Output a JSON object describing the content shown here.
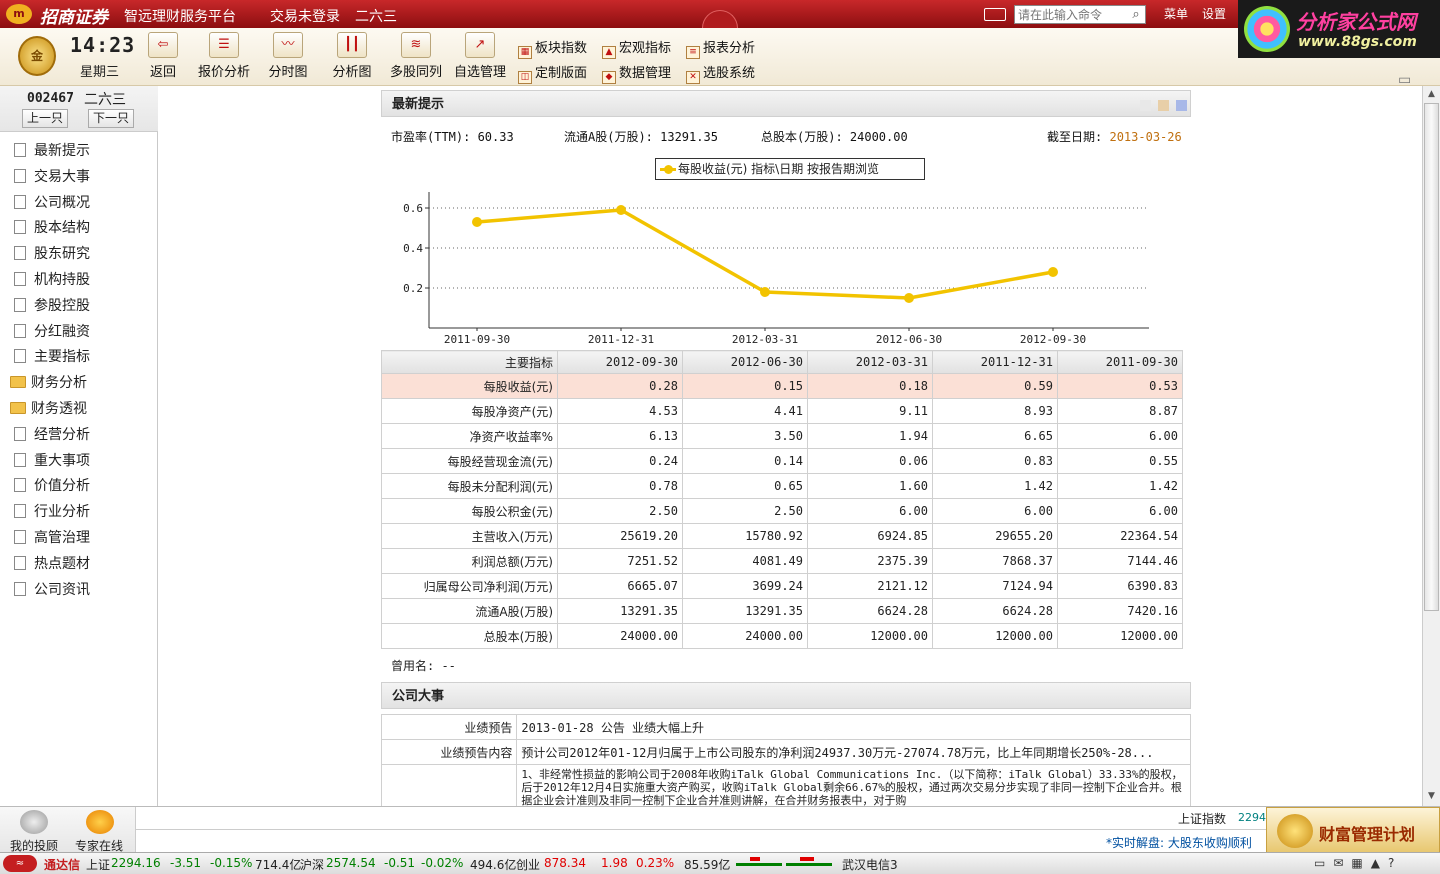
{
  "titlebar": {
    "logo_badge": "m",
    "brand": "招商证券",
    "platform": "智远理财服务平台",
    "login_status": "交易未登录",
    "stock_name": "二六三",
    "command_placeholder": "请在此输入命令",
    "menu_label": "菜单",
    "settings_label": "设置"
  },
  "toolbar": {
    "gold_badge": "金",
    "clock": "14:23",
    "weekday": "星期三",
    "buttons": [
      {
        "label": "返回",
        "icon": "back-arrow-icon"
      },
      {
        "label": "报价分析",
        "icon": "quote-analysis-icon"
      },
      {
        "label": "分时图",
        "icon": "intraday-chart-icon"
      },
      {
        "label": "分析图",
        "icon": "candlestick-chart-icon"
      },
      {
        "label": "多股同列",
        "icon": "multi-stock-icon"
      },
      {
        "label": "自选管理",
        "icon": "watchlist-icon"
      }
    ],
    "small_buttons": [
      {
        "label": "板块指数"
      },
      {
        "label": "宏观指标"
      },
      {
        "label": "报表分析"
      },
      {
        "label": "定制版面"
      },
      {
        "label": "数据管理"
      },
      {
        "label": "选股系统"
      }
    ]
  },
  "ad": {
    "title": "分析家公式网",
    "url": "www.88gs.com"
  },
  "sidebar": {
    "stock_code": "002467",
    "stock_name": "二六三",
    "prev_label": "上一只",
    "next_label": "下一只",
    "items": [
      {
        "label": "最新提示",
        "type": "doc"
      },
      {
        "label": "交易大事",
        "type": "doc"
      },
      {
        "label": "公司概况",
        "type": "doc"
      },
      {
        "label": "股本结构",
        "type": "doc"
      },
      {
        "label": "股东研究",
        "type": "doc"
      },
      {
        "label": "机构持股",
        "type": "doc"
      },
      {
        "label": "参股控股",
        "type": "doc"
      },
      {
        "label": "分红融资",
        "type": "doc"
      },
      {
        "label": "主要指标",
        "type": "doc"
      },
      {
        "label": "财务分析",
        "type": "folder"
      },
      {
        "label": "财务透视",
        "type": "folder"
      },
      {
        "label": "经营分析",
        "type": "doc"
      },
      {
        "label": "重大事项",
        "type": "doc"
      },
      {
        "label": "价值分析",
        "type": "doc"
      },
      {
        "label": "行业分析",
        "type": "doc"
      },
      {
        "label": "高管治理",
        "type": "doc"
      },
      {
        "label": "热点题材",
        "type": "doc"
      },
      {
        "label": "公司资讯",
        "type": "doc"
      }
    ]
  },
  "latest": {
    "title": "最新提示",
    "pe_label": "市盈率(TTM): 60.33",
    "float_label": "流通A股(万股): 13291.35",
    "total_label": "总股本(万股): 24000.00",
    "as_of_label": "截至日期:",
    "as_of_value": "2013-03-26",
    "used_name": "曾用名: --"
  },
  "chart_data": {
    "type": "line",
    "legend": "每股收益(元)   指标\\日期   按报告期浏览",
    "x": [
      "2011-09-30",
      "2011-12-31",
      "2012-03-31",
      "2012-06-30",
      "2012-09-30"
    ],
    "series": [
      {
        "name": "每股收益(元)",
        "values": [
          0.53,
          0.59,
          0.18,
          0.15,
          0.28
        ]
      }
    ],
    "yticks": [
      "0.2",
      "0.4",
      "0.6"
    ],
    "ylim": [
      0,
      0.68
    ],
    "grid": true,
    "color": "#f2c300"
  },
  "metrics": {
    "header": [
      "主要指标",
      "2012-09-30",
      "2012-06-30",
      "2012-03-31",
      "2011-12-31",
      "2011-09-30"
    ],
    "rows": [
      [
        "每股收益(元)",
        "0.28",
        "0.15",
        "0.18",
        "0.59",
        "0.53"
      ],
      [
        "每股净资产(元)",
        "4.53",
        "4.41",
        "9.11",
        "8.93",
        "8.87"
      ],
      [
        "净资产收益率%",
        "6.13",
        "3.50",
        "1.94",
        "6.65",
        "6.00"
      ],
      [
        "每股经营现金流(元)",
        "0.24",
        "0.14",
        "0.06",
        "0.83",
        "0.55"
      ],
      [
        "每股未分配利润(元)",
        "0.78",
        "0.65",
        "1.60",
        "1.42",
        "1.42"
      ],
      [
        "每股公积金(元)",
        "2.50",
        "2.50",
        "6.00",
        "6.00",
        "6.00"
      ],
      [
        "主营收入(万元)",
        "25619.20",
        "15780.92",
        "6924.85",
        "29655.20",
        "22364.54"
      ],
      [
        "利润总额(万元)",
        "7251.52",
        "4081.49",
        "2375.39",
        "7868.37",
        "7144.46"
      ],
      [
        "归属母公司净利润(万元)",
        "6665.07",
        "3699.24",
        "2121.12",
        "7124.94",
        "6390.83"
      ],
      [
        "流通A股(万股)",
        "13291.35",
        "13291.35",
        "6624.28",
        "6624.28",
        "7420.16"
      ],
      [
        "总股本(万股)",
        "24000.00",
        "24000.00",
        "12000.00",
        "12000.00",
        "12000.00"
      ]
    ]
  },
  "events": {
    "title": "公司大事",
    "rows": [
      {
        "label": "业绩预告",
        "text": "2013-01-28 公告 业绩大幅上升"
      },
      {
        "label": "业绩预告内容",
        "text": "预计公司2012年01-12月归属于上市公司股东的净利润24937.30万元-27074.78万元，比上年同期增长250%-28..."
      },
      {
        "label": "",
        "text": "1、非经常性损益的影响公司于2008年收购iTalk Global Communications Inc.（以下简称：iTalk Global）33.33%的股权，后于2012年12月4日实施重大资产购买，收购iTalk Global剩余66.67%的股权，通过两次交易分步实现了非同一控制下企业合并。根据企业会计准则及非同一控制下企业合并准则讲解，在合并财务报表中，对于购"
      }
    ]
  },
  "bottom": {
    "advisor_label": "我的投顾",
    "expert_label": "专家在线",
    "sh_index_label": "上证指数",
    "sh_index_value": "2294.",
    "news": "*实时解盘: 大股东收购顺利",
    "wealth_label": "财富管理计划"
  },
  "status": {
    "start": "≈",
    "app": "通达信",
    "sh_label": "上证",
    "sh_value": "2294.16",
    "sh_change": "-3.51",
    "sh_pct": "-0.15%",
    "sh_amount": "714.4亿",
    "hs_label": "沪深",
    "hs_value": "2574.54",
    "hs_change": "-0.51",
    "hs_pct": "-0.02%",
    "hs_amount": "494.6亿",
    "cy_label": "创业",
    "cy_value": "878.34",
    "cy_change": "1.98",
    "cy_pct": "0.23%",
    "cy_amount": "85.59亿",
    "server": "武汉电信3"
  }
}
